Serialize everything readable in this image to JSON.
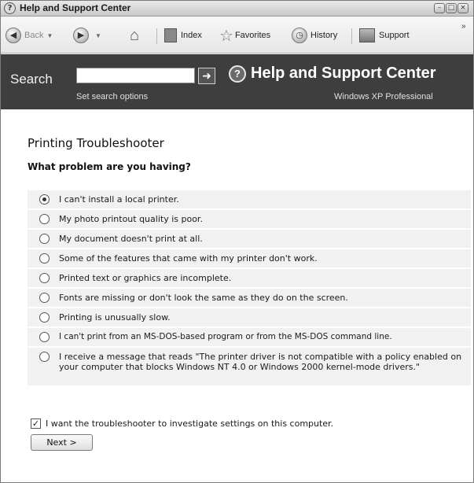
{
  "window": {
    "title": "Help and Support Center",
    "app_icon": "help-icon"
  },
  "titlebar_buttons": {
    "minimize_icon": "minimize-icon",
    "maximize_icon": "maximize-icon",
    "close_icon": "close-icon"
  },
  "toolbar": {
    "back_label": "Back",
    "index_label": "Index",
    "favorites_label": "Favorites",
    "history_label": "History",
    "support_label": "Support"
  },
  "search": {
    "label": "Search",
    "value": "",
    "options_link": "Set search options"
  },
  "header": {
    "title": "Help and Support Center",
    "edition": "Windows XP Professional"
  },
  "main": {
    "page_title": "Printing Troubleshooter",
    "question": "What problem are you having?",
    "options": [
      {
        "label": "I can't install a local printer.",
        "selected": true
      },
      {
        "label": "My photo printout quality is poor.",
        "selected": false
      },
      {
        "label": "My document doesn't print at all.",
        "selected": false
      },
      {
        "label": "Some of the features that came with my printer don't work.",
        "selected": false
      },
      {
        "label": "Printed text or graphics are incomplete.",
        "selected": false
      },
      {
        "label": "Fonts are missing or don't look the same as they do on the screen.",
        "selected": false
      },
      {
        "label": "Printing is unusually slow.",
        "selected": false
      },
      {
        "label": "I can't print from an MS-DOS-based program or from the MS-DOS command line.",
        "selected": false
      },
      {
        "label": "I receive a message that reads \"The printer driver is not compatible with a policy enabled on your computer that blocks Windows NT 4.0 or Windows 2000 kernel-mode drivers.\"",
        "selected": false
      }
    ],
    "investigate_label": "I want the troubleshooter to investigate settings on this computer.",
    "investigate_checked": true,
    "next_label": "Next >"
  }
}
